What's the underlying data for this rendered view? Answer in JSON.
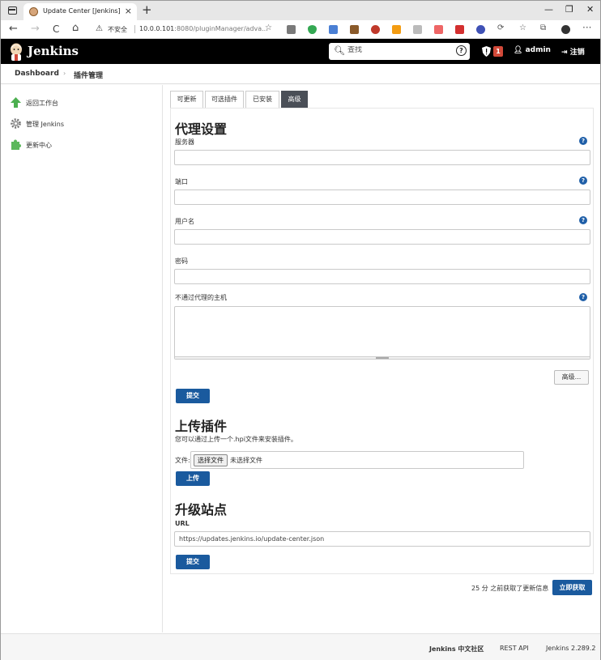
{
  "browser": {
    "tab_title": "Update Center [Jenkins]",
    "tab_close": "×",
    "new_tab": "+",
    "window_controls": [
      "—",
      "❐",
      "✕"
    ],
    "address_insecure": "不安全",
    "address_host": "10.0.0.101",
    "address_path": ":8080/pluginManager/adva...",
    "nav": {
      "back": "←",
      "forward": "→",
      "reload": "C",
      "home": "⌂"
    },
    "menu": "···"
  },
  "header": {
    "title": "Jenkins",
    "search_placeholder": "查找",
    "help": "?",
    "alert_count": "1",
    "user": "admin",
    "logout": "注销"
  },
  "breadcrumb": {
    "home": "Dashboard",
    "sep": "›",
    "current": "插件管理"
  },
  "sidebar": {
    "items": [
      {
        "label": "返回工作台",
        "icon": "up-arrow-icon"
      },
      {
        "label": "管理 Jenkins",
        "icon": "gear-icon"
      },
      {
        "label": "更新中心",
        "icon": "puzzle-icon"
      }
    ]
  },
  "tabs": [
    "可更新",
    "可选插件",
    "已安装",
    "高级"
  ],
  "active_tab": "高级",
  "proxy": {
    "heading": "代理设置",
    "server_label": "服务器",
    "port_label": "端口",
    "username_label": "用户名",
    "password_label": "密码",
    "no_proxy_label": "不通过代理的主机",
    "advanced_button": "高级...",
    "submit_button": "提交",
    "help": "?"
  },
  "upload": {
    "heading": "上传插件",
    "description": "您可以通过上传一个.hpi文件来安装插件。",
    "file_label": "文件:",
    "choose_button": "选择文件",
    "no_file": "未选择文件",
    "upload_button": "上传"
  },
  "site": {
    "heading": "升级站点",
    "url_label": "URL",
    "url_value": "https://updates.jenkins.io/update-center.json",
    "submit_button": "提交"
  },
  "fetch": {
    "info": "25 分 之前获取了更新信息",
    "button": "立即获取"
  },
  "footer": {
    "community": "Jenkins 中文社区",
    "rest_api": "REST API",
    "version": "Jenkins 2.289.2"
  },
  "colors": {
    "primary": "#1a5a9e",
    "header_bg": "#000000",
    "active_tab": "#4a4f57",
    "alert": "#d24939"
  }
}
